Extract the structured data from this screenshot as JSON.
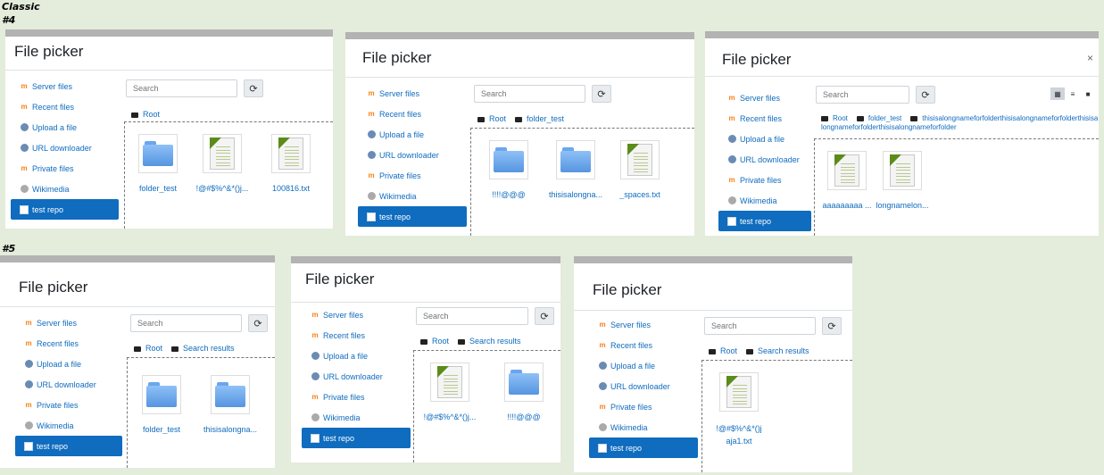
{
  "captions": {
    "classic": "Classic",
    "n4": "#4",
    "n5": "#5"
  },
  "title": "File picker",
  "search_placeholder": "Search",
  "refresh_glyph": "⟳",
  "close_glyph": "×",
  "sidebar": [
    {
      "label": "Server files",
      "icon": "moodle-icon"
    },
    {
      "label": "Recent files",
      "icon": "moodle-icon"
    },
    {
      "label": "Upload a file",
      "icon": "upload-icon"
    },
    {
      "label": "URL downloader",
      "icon": "url-icon"
    },
    {
      "label": "Private files",
      "icon": "moodle-icon"
    },
    {
      "label": "Wikimedia",
      "icon": "wikimedia-icon"
    },
    {
      "label": "test repo",
      "icon": "repo-icon",
      "active": true
    }
  ],
  "panels": [
    {
      "crumbs": [
        "Root"
      ],
      "files": [
        {
          "name": "folder_test",
          "type": "folder"
        },
        {
          "name": "!@#$%^&*()j...",
          "type": "file"
        },
        {
          "name": "100816.txt",
          "type": "file"
        }
      ]
    },
    {
      "crumbs": [
        "Root",
        "folder_test"
      ],
      "files": [
        {
          "name": "!!!!@@@",
          "type": "folder"
        },
        {
          "name": "thisisalongna...",
          "type": "folder"
        },
        {
          "name": "_spaces.txt",
          "type": "file"
        }
      ]
    },
    {
      "crumbs": [
        "Root",
        "folder_test",
        "thisisalongnameforfolderthisisalongnameforfolderthisisalongnameforfolderthisisalongnameforfolder"
      ],
      "files": [
        {
          "name": "aaaaaaaaa ...",
          "type": "file"
        },
        {
          "name": "longnamelon...",
          "type": "file"
        }
      ]
    },
    {
      "crumbs": [
        "Root",
        "Search results"
      ],
      "files": [
        {
          "name": "folder_test",
          "type": "folder"
        },
        {
          "name": "thisisalongna...",
          "type": "folder"
        }
      ]
    },
    {
      "crumbs": [
        "Root",
        "Search results"
      ],
      "files": [
        {
          "name": "!@#$%^&*()j...",
          "type": "file"
        },
        {
          "name": "!!!!@@@",
          "type": "folder"
        }
      ]
    },
    {
      "crumbs": [
        "Root",
        "Search results"
      ],
      "files": [
        {
          "name": "!@#$%^&*()jaja1.txt",
          "type": "file"
        }
      ]
    }
  ]
}
